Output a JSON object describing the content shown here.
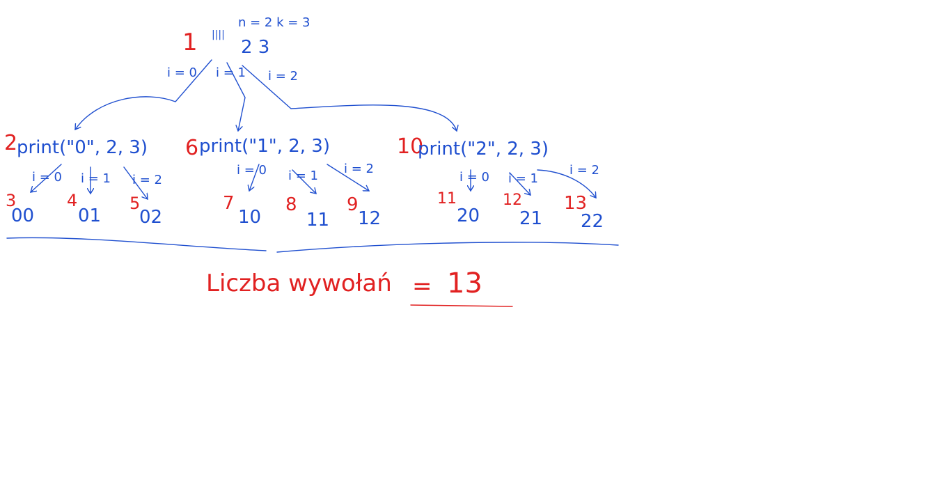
{
  "colors": {
    "ink_blue": "#1f4fcf",
    "ink_red": "#e12121",
    "background": "#ffffff"
  },
  "root": {
    "order": "1",
    "marks": "||||",
    "params": "n = 2   k = 3",
    "args": "2   3"
  },
  "root_edges": [
    "i = 0",
    "i = 1",
    "i = 2"
  ],
  "level1": [
    {
      "order": "2",
      "call": "print(\"0\", 2, 3)"
    },
    {
      "order": "6",
      "call": "print(\"1\", 2, 3)"
    },
    {
      "order": "10",
      "call": "print(\"2\", 2, 3)"
    }
  ],
  "level1_edges": [
    "i = 0",
    "i = 1",
    "i = 2",
    "i = 0",
    "i = 1",
    "i = 2",
    "i = 0",
    "i = 1",
    "i = 2"
  ],
  "leaves": [
    {
      "order": "3",
      "value": "00"
    },
    {
      "order": "4",
      "value": "01"
    },
    {
      "order": "5",
      "value": "02"
    },
    {
      "order": "7",
      "value": "10"
    },
    {
      "order": "8",
      "value": "11"
    },
    {
      "order": "9",
      "value": "12"
    },
    {
      "order": "11",
      "value": "20"
    },
    {
      "order": "12",
      "value": "21"
    },
    {
      "order": "13",
      "value": "22"
    }
  ],
  "summary": {
    "label": "Liczba wywołań",
    "equals": "=",
    "value": "13"
  }
}
